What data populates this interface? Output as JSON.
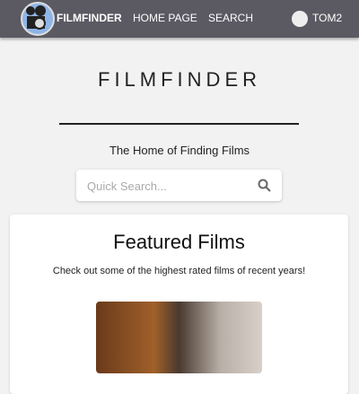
{
  "nav": {
    "brand": "FILMFINDER",
    "home": "HOME PAGE",
    "search": "SEARCH",
    "user": "TOM2"
  },
  "hero": {
    "title": "FILMFINDER",
    "subtitle": "The Home of Finding Films",
    "search_placeholder": "Quick Search..."
  },
  "featured": {
    "title": "Featured Films",
    "description": "Check out some of the highest rated films of recent years!"
  }
}
